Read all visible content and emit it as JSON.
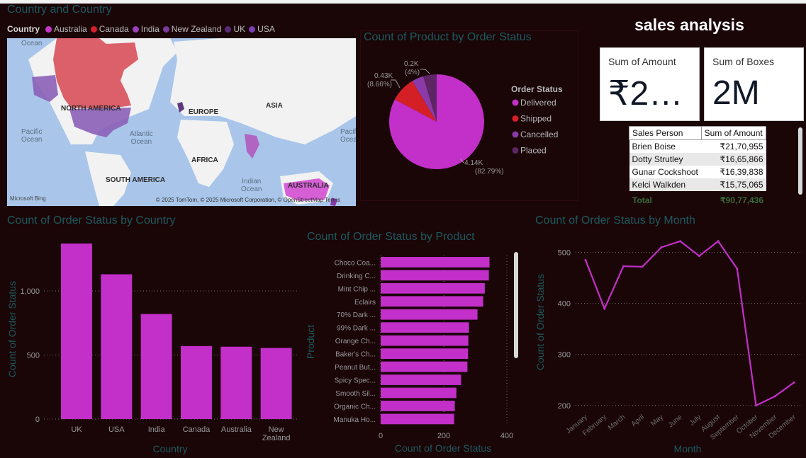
{
  "map_visual": {
    "title": "Country and Country",
    "legend_title": "Country",
    "legend": [
      {
        "label": "Australia",
        "color": "#c837cc"
      },
      {
        "label": "Canada",
        "color": "#d62027"
      },
      {
        "label": "India",
        "color": "#9a3fbe"
      },
      {
        "label": "New Zealand",
        "color": "#7a3a9e"
      },
      {
        "label": "UK",
        "color": "#5a2a7a"
      },
      {
        "label": "USA",
        "color": "#7b3fb5"
      }
    ],
    "labels": {
      "north_america": "NORTH AMERICA",
      "europe": "EUROPE",
      "asia": "ASIA",
      "africa": "AFRICA",
      "south_america": "SOUTH AMERICA",
      "australia": "AUSTRALIA",
      "ocean_top": "Ocean",
      "pacific": "Pacific\nOcean",
      "atlantic": "Atlantic\nOcean",
      "indian": "Indian\nOcean",
      "pacific_right": "Pacific\nOcean"
    },
    "attribution": "© 2025 TomTom, © 2025 Microsoft Corporation, © OpenStreetMap  Terms",
    "bing": "Microsoft Bing"
  },
  "header": {
    "title": "sales analysis"
  },
  "cards": [
    {
      "label": "Sum of Amount",
      "value": "₹2…"
    },
    {
      "label": "Sum of Boxes",
      "value": "2M"
    }
  ],
  "salesperson_table": {
    "headers": [
      "Sales Person",
      "Sum of Amount"
    ],
    "rows": [
      [
        "Brien Boise",
        "₹21,70,955"
      ],
      [
        "Dotty Strutley",
        "₹16,65,866"
      ],
      [
        "Gunar Cockshoot",
        "₹16,39,838"
      ],
      [
        "Kelci Walkden",
        "₹15,75,065"
      ]
    ],
    "total_label": "Total",
    "total_value": "₹90,77,436"
  },
  "pie_visual": {
    "title": "Count of Product by Order Status",
    "legend_title": "Order Status"
  },
  "country_visual": {
    "title": "Count of Order Status by Country"
  },
  "product_visual": {
    "title": "Count of Order Status by Product"
  },
  "month_visual": {
    "title": "Count of Order Status by Month"
  },
  "chart_data": [
    {
      "type": "pie",
      "title": "Count of Product by Order Status",
      "legend_title": "Order Status",
      "slices": [
        {
          "label": "Delivered",
          "value": 4140,
          "display": "4.14K",
          "pct": "(82.79%)",
          "color": "#c22fc9"
        },
        {
          "label": "Shipped",
          "value": 430,
          "display": "0.43K",
          "pct": "(8.66%)",
          "color": "#d41f26"
        },
        {
          "label": "Cancelled",
          "value": 200,
          "display": "0.2K",
          "pct": "(4%)",
          "color": "#8b3aa8"
        },
        {
          "label": "Placed",
          "value": 230,
          "display": "",
          "pct": "",
          "color": "#5e2565"
        }
      ]
    },
    {
      "type": "bar",
      "title": "Count of Order Status by Country",
      "xlabel": "Country",
      "ylabel": "Count of Order Status",
      "categories": [
        "UK",
        "USA",
        "India",
        "Canada",
        "Australia",
        "New Zealand"
      ],
      "values": [
        1370,
        1130,
        820,
        570,
        565,
        555
      ],
      "yticks": [
        0,
        500,
        1000
      ],
      "ytick_labels": [
        "0",
        "500",
        "1,000"
      ],
      "ylim": [
        0,
        1420
      ],
      "color": "#c22fc9"
    },
    {
      "type": "bar",
      "orientation": "horizontal",
      "title": "Count of Order Status by Product",
      "xlabel": "Count of Order Status",
      "ylabel": "Product",
      "categories": [
        "Choco Coa...",
        "Drinking C...",
        "Mint Chip ...",
        "Eclairs",
        "70% Dark ...",
        "99% Dark ...",
        "Orange Ch...",
        "Baker's Ch...",
        "Peanut But...",
        "Spicy Spec...",
        "Smooth Sil...",
        "Organic Ch...",
        "Manuka Ho..."
      ],
      "values": [
        345,
        343,
        330,
        325,
        307,
        280,
        278,
        277,
        275,
        255,
        240,
        235,
        233
      ],
      "xticks": [
        0,
        200,
        400
      ],
      "xlim": [
        0,
        400
      ],
      "color": "#c22fc9"
    },
    {
      "type": "line",
      "title": "Count of Order Status by Month",
      "xlabel": "Month",
      "ylabel": "Count of Order Status",
      "categories": [
        "January",
        "February",
        "March",
        "April",
        "May",
        "June",
        "July",
        "August",
        "September",
        "October",
        "November",
        "December"
      ],
      "values": [
        485,
        390,
        473,
        472,
        510,
        522,
        493,
        522,
        468,
        200,
        218,
        245
      ],
      "yticks": [
        200,
        300,
        400,
        500
      ],
      "ylim": [
        190,
        530
      ],
      "color": "#c22fc9"
    }
  ]
}
